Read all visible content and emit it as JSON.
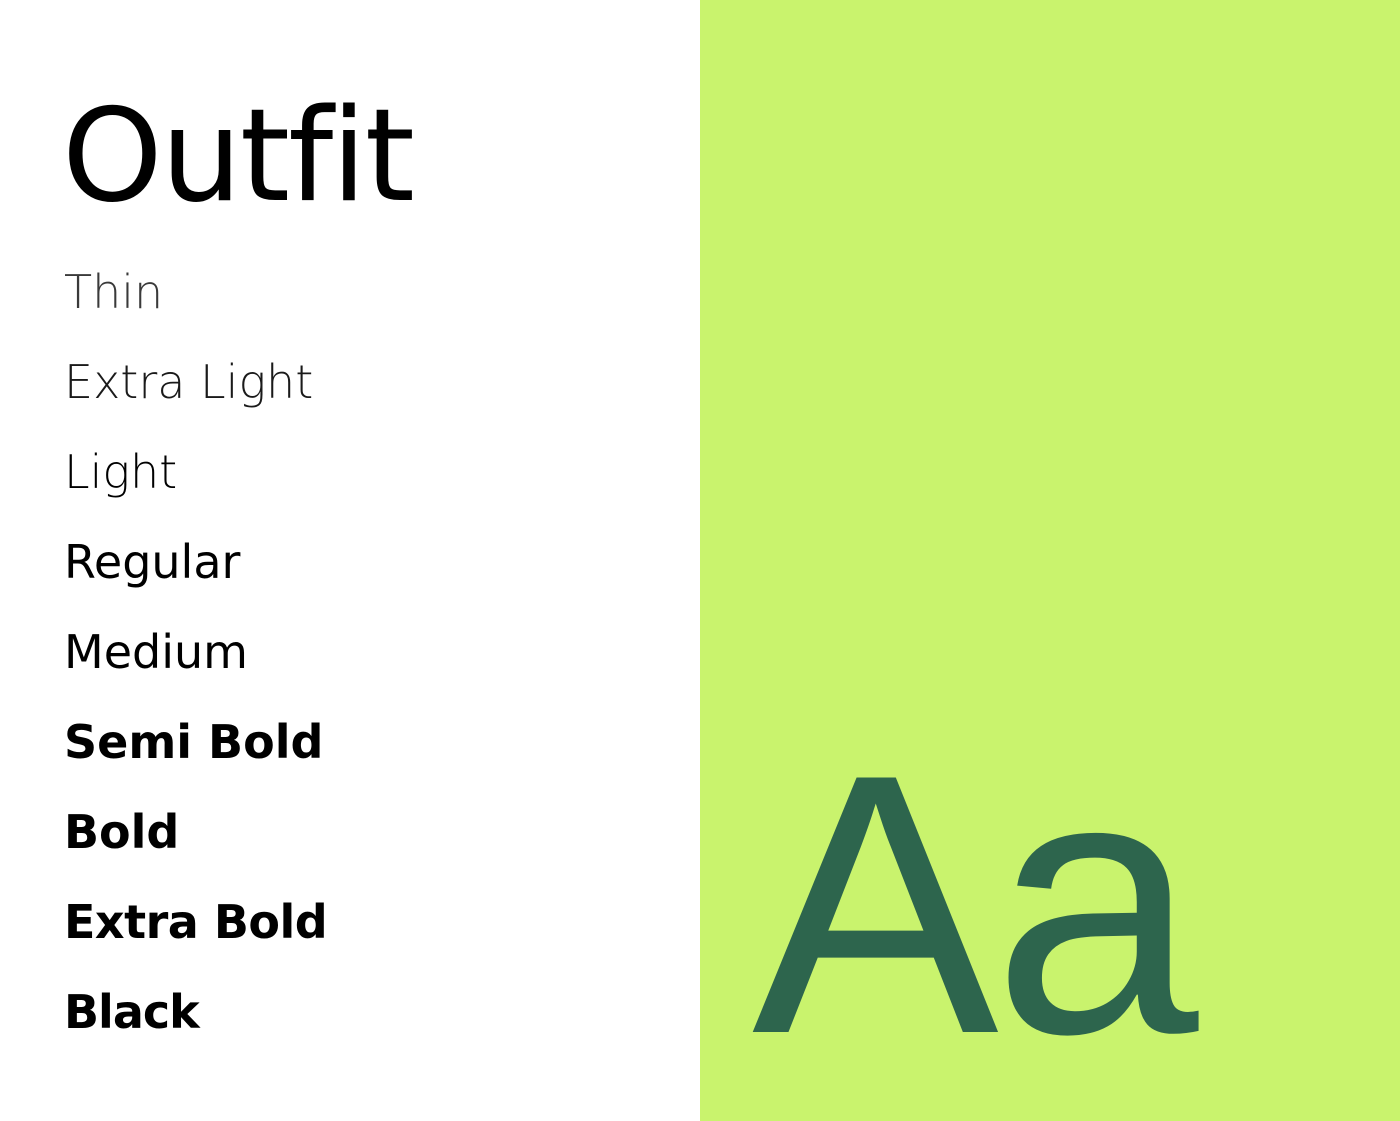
{
  "font_name": "Outfit",
  "weights": [
    "Thin",
    "Extra Light",
    "Light",
    "Regular",
    "Medium",
    "Semi Bold",
    "Bold",
    "Extra Bold",
    "Black"
  ],
  "specimen": {
    "glyphs": "Aa"
  },
  "colors": {
    "background_left": "#ffffff",
    "background_right": "#c9f36d",
    "specimen_text": "#2d654d",
    "text": "#000000"
  }
}
